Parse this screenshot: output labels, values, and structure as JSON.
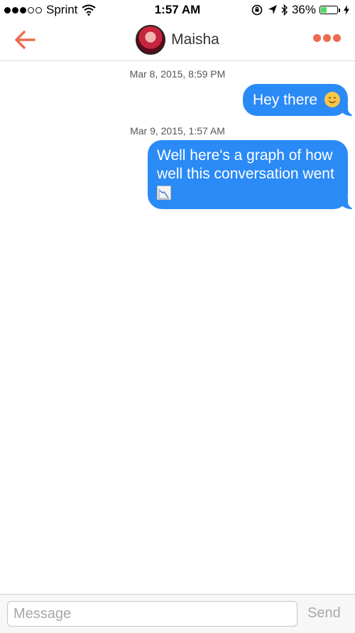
{
  "status_bar": {
    "carrier": "Sprint",
    "signal_bars": 3,
    "signal_total": 5,
    "time": "1:57 AM",
    "battery_percent": "36%",
    "battery_level": 0.36,
    "icons": [
      "wifi-icon",
      "rotation-lock-icon",
      "location-arrow-icon",
      "bluetooth-icon",
      "battery-icon",
      "charging-bolt-icon"
    ]
  },
  "header": {
    "contact_name": "Maisha",
    "back_icon": "back-arrow-icon",
    "more_icon": "more-dots-icon",
    "accent_color": "#f06b4e"
  },
  "conversation": {
    "bubble_color": "#2a8af6",
    "messages": [
      {
        "timestamp": "Mar 8, 2015, 8:59 PM",
        "text": "Hey there",
        "emoji": "smiling-face-emoji"
      },
      {
        "timestamp": "Mar 9, 2015, 1:57 AM",
        "line1": "Well here's a graph of how",
        "line2": "well this conversation went",
        "emoji": "chart-decreasing-emoji"
      }
    ]
  },
  "composer": {
    "placeholder": "Message",
    "value": "",
    "send_label": "Send"
  }
}
